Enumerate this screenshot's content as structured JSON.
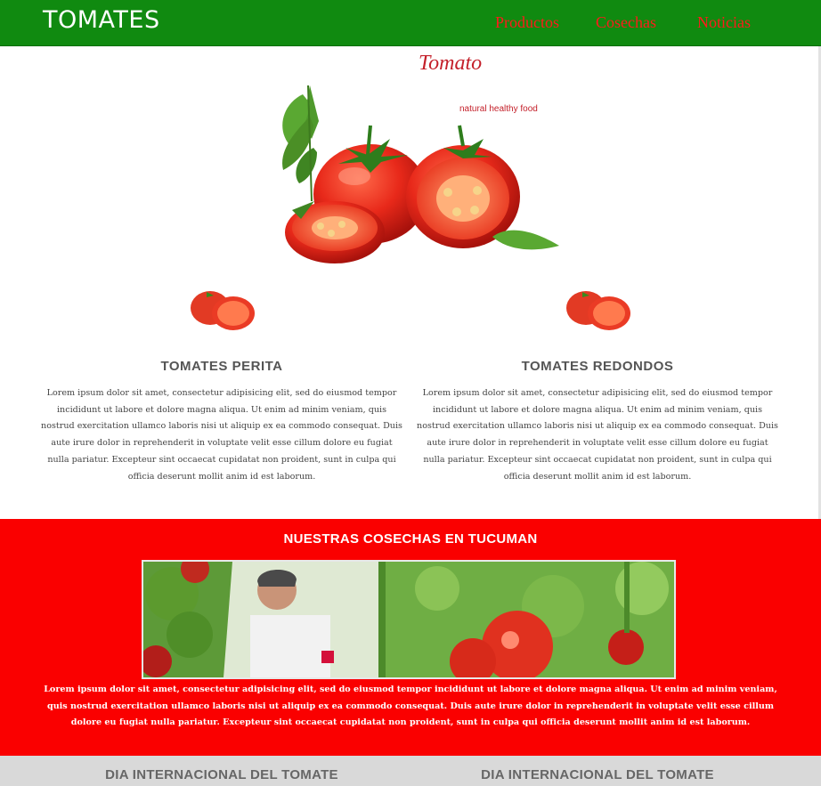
{
  "header": {
    "brand": "TOMATES",
    "nav": [
      {
        "label": "Productos"
      },
      {
        "label": "Cosechas"
      },
      {
        "label": "Noticias"
      }
    ],
    "bg_color": "#108a10",
    "link_color": "#ff1a1a"
  },
  "hero": {
    "logo_title": "Tomato",
    "logo_subtitle": "natural healthy food"
  },
  "products": [
    {
      "title": "TOMATES PERITA",
      "text": "Lorem ipsum dolor sit amet, consectetur adipisicing elit, sed do eiusmod tempor incididunt ut labore et dolore magna aliqua. Ut enim ad minim veniam, quis nostrud exercitation ullamco laboris nisi ut aliquip ex ea commodo consequat. Duis aute irure dolor in reprehenderit in voluptate velit esse cillum dolore eu fugiat nulla pariatur. Excepteur sint occaecat cupidatat non proident, sunt in culpa qui officia deserunt mollit anim id est laborum."
    },
    {
      "title": "TOMATES REDONDOS",
      "text": "Lorem ipsum dolor sit amet, consectetur adipisicing elit, sed do eiusmod tempor incididunt ut labore et dolore magna aliqua. Ut enim ad minim veniam, quis nostrud exercitation ullamco laboris nisi ut aliquip ex ea commodo consequat. Duis aute irure dolor in reprehenderit in voluptate velit esse cillum dolore eu fugiat nulla pariatur. Excepteur sint occaecat cupidatat non proident, sunt in culpa qui officia deserunt mollit anim id est laborum."
    }
  ],
  "harvest": {
    "title": "NUESTRAS COSECHAS EN TUCUMAN",
    "text": "Lorem ipsum dolor sit amet, consectetur adipisicing elit, sed do eiusmod tempor incididunt ut labore et dolore magna aliqua. Ut enim ad minim veniam, quis nostrud exercitation ullamco laboris nisi ut aliquip ex ea commodo consequat. Duis aute irure dolor in reprehenderit in voluptate velit esse cillum dolore eu fugiat nulla pariatur. Excepteur sint occaecat cupidatat non proident, sunt in culpa qui officia deserunt mollit anim id est laborum.",
    "bg_color": "#fa0000"
  },
  "news": [
    {
      "title": "DIA INTERNACIONAL DEL TOMATE"
    },
    {
      "title": "DIA INTERNACIONAL DEL TOMATE"
    }
  ]
}
